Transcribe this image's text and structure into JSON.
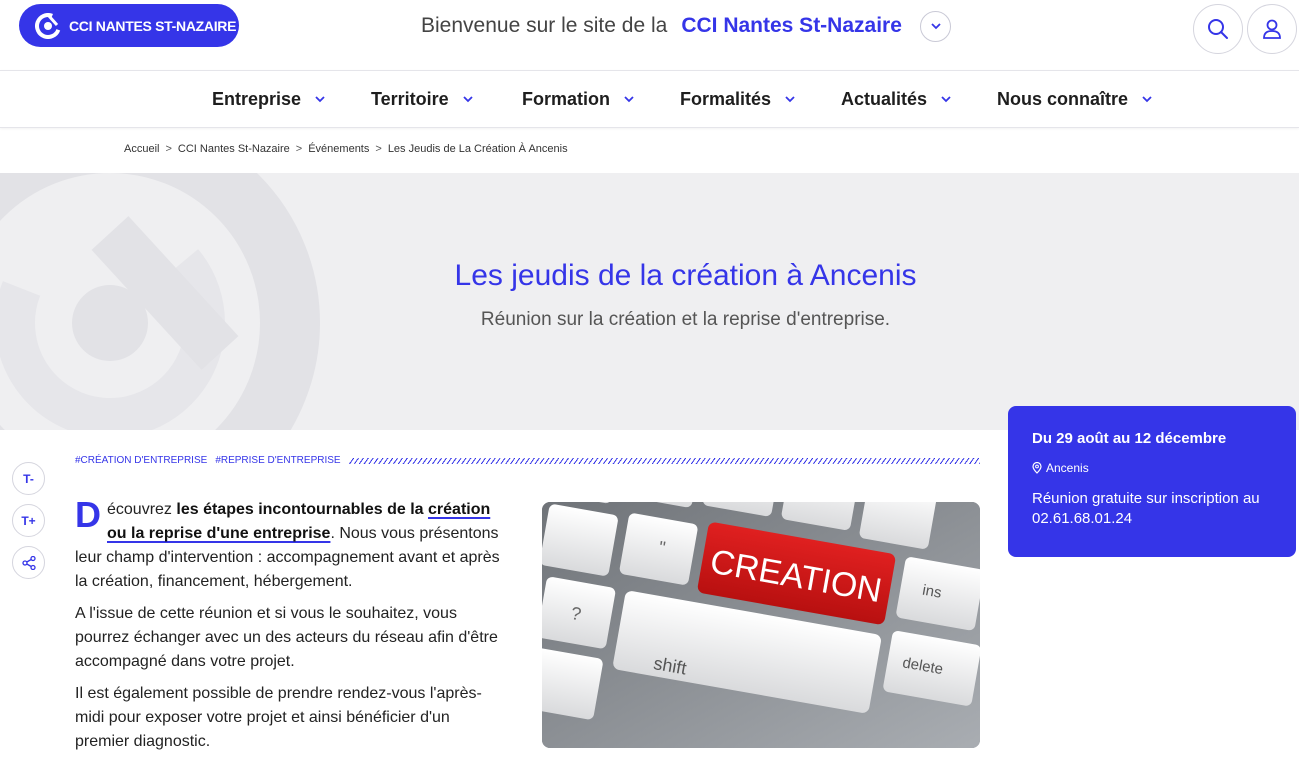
{
  "header": {
    "logo_label": "CCI NANTES ST-NAZAIRE",
    "welcome_text": "Bienvenue sur le site de la",
    "welcome_brand": "CCI Nantes St-Nazaire"
  },
  "nav": {
    "items": [
      {
        "label": "Entreprise"
      },
      {
        "label": "Territoire"
      },
      {
        "label": "Formation"
      },
      {
        "label": "Formalités"
      },
      {
        "label": "Actualités"
      },
      {
        "label": "Nous connaître"
      }
    ]
  },
  "breadcrumb": {
    "items": [
      "Accueil",
      "CCI Nantes St-Nazaire",
      "Événements",
      "Les Jeudis de La Création À Ancenis"
    ],
    "separator": ">"
  },
  "hero": {
    "title": "Les jeudis de la création à Ancenis",
    "subtitle": "Réunion sur la création et la reprise d'entreprise."
  },
  "event": {
    "dates": "Du 29 août au 12 décembre",
    "location": "Ancenis",
    "info": "Réunion gratuite sur inscription au 02.61.68.01.24"
  },
  "tools": {
    "decrease": "T-",
    "increase": "T+"
  },
  "tags": [
    "#CRÉATION D'ENTREPRISE",
    "#REPRISE D'ENTREPRISE"
  ],
  "article": {
    "dropcap": "D",
    "p1_start": "écouvrez ",
    "p1_bold": "les étapes incontournables de la ",
    "p1_link": "création ou la reprise d'une entreprise",
    "p1_end": ". Nous vous présentons leur champ d'intervention : accompagnement avant et après la création, financement, hébergement.",
    "p2": "A l'issue de cette réunion et si vous le souhaitez, vous pourrez échanger avec un des acteurs du réseau afin d'être accompagné dans votre projet.",
    "p3": "Il est également possible de prendre rendez-vous l'après-midi pour exposer votre projet et ainsi bénéficier d'un premier diagnostic."
  },
  "photo": {
    "key_label": "CREATION",
    "keys": [
      "shift",
      "delete",
      "ins"
    ]
  },
  "colors": {
    "brand": "#3535e8",
    "hero_bg": "#efeff1",
    "key_red": "#d41818"
  }
}
